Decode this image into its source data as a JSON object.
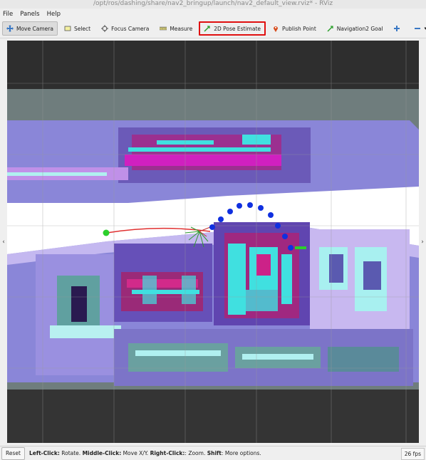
{
  "window": {
    "title": "/opt/ros/dashing/share/nav2_bringup/launch/nav2_default_view.rviz* - RViz"
  },
  "menu": {
    "file": "File",
    "panels": "Panels",
    "help": "Help"
  },
  "toolbar": {
    "move_camera": "Move Camera",
    "select": "Select",
    "focus_camera": "Focus Camera",
    "measure": "Measure",
    "pose_estimate": "2D Pose Estimate",
    "publish_point": "Publish Point",
    "nav_goal": "Navigation2 Goal"
  },
  "status": {
    "reset": "Reset",
    "left_click_key": "Left-Click:",
    "left_click_val": " Rotate. ",
    "middle_click_key": "Middle-Click:",
    "middle_click_val": " Move X/Y. ",
    "right_click_key": "Right-Click:",
    "right_click_val": ": Zoom. ",
    "shift_key": "Shift",
    "shift_val": ": More options.",
    "fps": "26 fps"
  },
  "colors": {
    "highlight_border": "#e01010",
    "path_dots": "#1030e0",
    "goal_marker": "#2ccf2c",
    "planned_path": "#e03030"
  }
}
